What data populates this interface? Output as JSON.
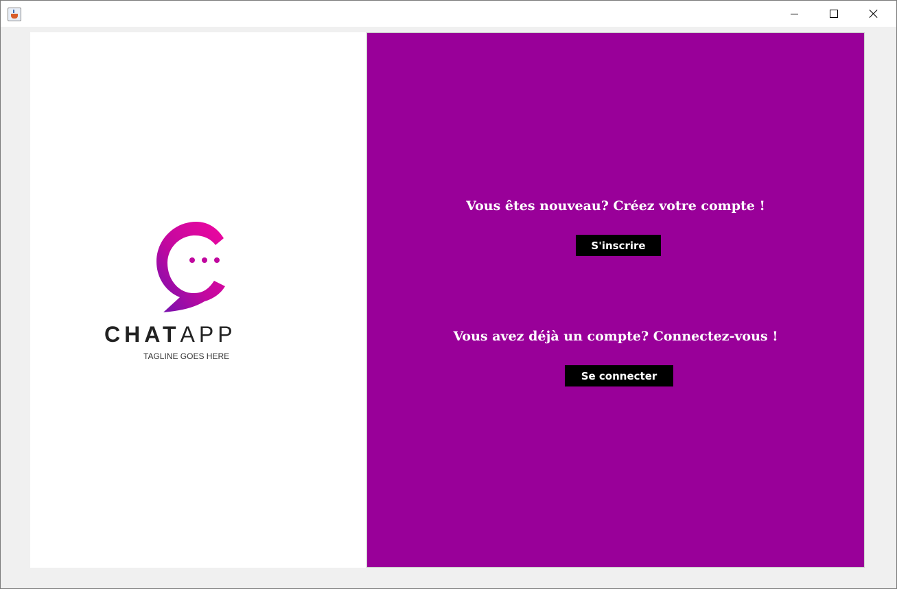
{
  "window": {
    "title": "",
    "controls": {
      "minimize_icon": "minimize-icon",
      "maximize_icon": "maximize-icon",
      "close_icon": "close-icon"
    }
  },
  "branding": {
    "name_strong": "CHAT",
    "name_light": "APP",
    "tagline": "TAGLINE GOES HERE"
  },
  "auth": {
    "signup_prompt": "Vous êtes nouveau? Créez votre compte !",
    "signup_button": "S'inscrire",
    "login_prompt": "Vous avez déjà un compte? Connectez-vous !",
    "login_button": "Se connecter"
  },
  "colors": {
    "accent_panel": "#990099",
    "button_bg": "#000000",
    "logo_gradient_start": "#f0079f",
    "logo_gradient_end": "#7a0fb0"
  }
}
